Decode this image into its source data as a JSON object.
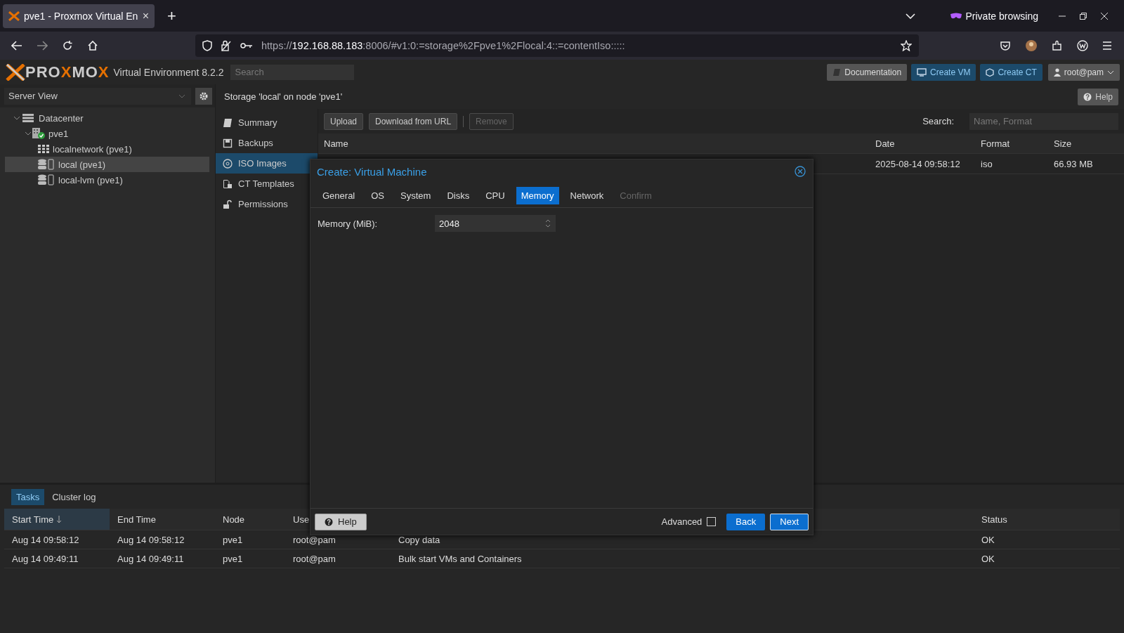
{
  "browser": {
    "tab": {
      "title": "pve1 - Proxmox Virtual En",
      "close": "×"
    },
    "new_tab": "+",
    "private_label": "Private browsing",
    "url": {
      "scheme": "https://",
      "host": "192.168.88.183",
      "rest": ":8006/#v1:0:=storage%2Fpve1%2Flocal:4::=contentIso:::::"
    }
  },
  "header": {
    "logo": [
      {
        "text": "PRO",
        "accent": false
      },
      {
        "text": "X",
        "accent": true
      },
      {
        "text": "MO",
        "accent": false
      },
      {
        "text": "X",
        "accent": true
      }
    ],
    "version": "Virtual Environment 8.2.2",
    "search_placeholder": "Search",
    "buttons": [
      {
        "label": "Documentation",
        "kind": "doc"
      },
      {
        "label": "Create VM",
        "kind": "vm"
      },
      {
        "label": "Create CT",
        "kind": "ct"
      }
    ],
    "user": "root@pam"
  },
  "sidebar": {
    "view": "Server View",
    "tree": [
      {
        "label": "Datacenter",
        "kind": "datacenter",
        "expanded": true,
        "selected": false,
        "children": [
          {
            "label": "pve1",
            "kind": "node",
            "expanded": true,
            "selected": false,
            "children": [
              {
                "label": "localnetwork (pve1)",
                "kind": "network",
                "selected": false
              },
              {
                "label": "local (pve1)",
                "kind": "storage",
                "selected": true
              },
              {
                "label": "local-lvm (pve1)",
                "kind": "storage",
                "selected": false
              }
            ]
          }
        ]
      }
    ]
  },
  "content": {
    "title": "Storage 'local' on node 'pve1'",
    "help": "Help",
    "nav": [
      {
        "label": "Summary",
        "kind": "summary",
        "selected": false
      },
      {
        "label": "Backups",
        "kind": "backup",
        "selected": false
      },
      {
        "label": "ISO Images",
        "kind": "iso",
        "selected": true
      },
      {
        "label": "CT Templates",
        "kind": "template",
        "selected": false
      },
      {
        "label": "Permissions",
        "kind": "lock",
        "selected": false
      }
    ],
    "toolbar": [
      {
        "label": "Upload",
        "disabled": false
      },
      {
        "label": "Download from URL",
        "disabled": false
      },
      {
        "label": "Remove",
        "disabled": true
      }
    ],
    "search_label": "Search:",
    "search_placeholder": "Name, Format",
    "columns": [
      "Name",
      "Date",
      "Format",
      "Size"
    ],
    "rows": [
      {
        "date": "2025-08-14 09:58:12",
        "format": "iso",
        "size": "66.93 MB"
      }
    ]
  },
  "dialog": {
    "title": "Create: Virtual Machine",
    "tabs": [
      {
        "label": "General",
        "selected": false,
        "disabled": false
      },
      {
        "label": "OS",
        "selected": false,
        "disabled": false
      },
      {
        "label": "System",
        "selected": false,
        "disabled": false
      },
      {
        "label": "Disks",
        "selected": false,
        "disabled": false
      },
      {
        "label": "CPU",
        "selected": false,
        "disabled": false
      },
      {
        "label": "Memory",
        "selected": true,
        "disabled": false
      },
      {
        "label": "Network",
        "selected": false,
        "disabled": false
      },
      {
        "label": "Confirm",
        "selected": false,
        "disabled": true
      }
    ],
    "field": {
      "label": "Memory (MiB):",
      "value": "2048"
    },
    "help": "Help",
    "advanced": {
      "label": "Advanced",
      "checked": false
    },
    "back": "Back",
    "next": "Next"
  },
  "tasks": {
    "tabs": [
      {
        "label": "Tasks",
        "selected": true
      },
      {
        "label": "Cluster log",
        "selected": false
      }
    ],
    "columns": [
      {
        "label": "Start Time",
        "sorted": true
      },
      {
        "label": "End Time",
        "sorted": false
      },
      {
        "label": "Node",
        "sorted": false
      },
      {
        "label": "Use",
        "sorted": false
      },
      {
        "label": "Status",
        "sorted": false
      }
    ],
    "rows": [
      {
        "start": "Aug 14 09:58:12",
        "end": "Aug 14 09:58:12",
        "node": "pve1",
        "user": "root@pam",
        "description": "Copy data",
        "status": "OK"
      },
      {
        "start": "Aug 14 09:49:11",
        "end": "Aug 14 09:49:11",
        "node": "pve1",
        "user": "root@pam",
        "description": "Bulk start VMs and Containers",
        "status": "OK"
      }
    ]
  }
}
